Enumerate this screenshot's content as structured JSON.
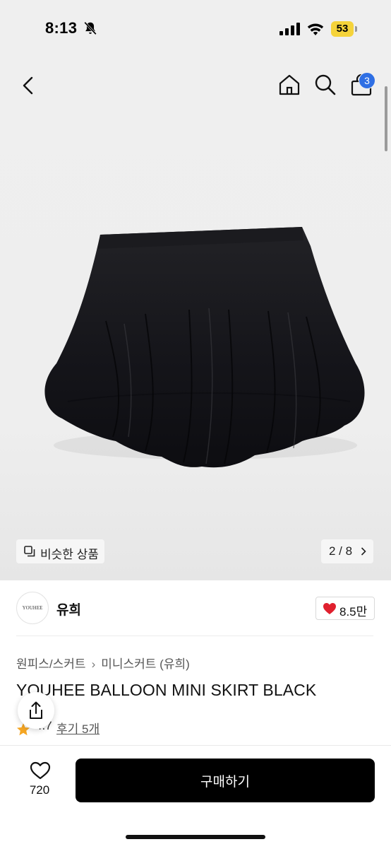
{
  "status_bar": {
    "time": "8:13",
    "battery": "53",
    "battery_color": "#f5d33a"
  },
  "nav": {
    "icons": [
      "chevron-left-icon",
      "home-icon",
      "search-icon",
      "shopping-bag-icon"
    ],
    "cart_badge": "3",
    "badge_color": "#2f6fe4"
  },
  "gallery": {
    "similar_label": "비슷한 상품",
    "page_indicator": "2 / 8"
  },
  "brand": {
    "logo_text": "YOUHEE",
    "name": "유희",
    "likes": "8.5만",
    "heart_color": "#e0202e"
  },
  "product": {
    "breadcrumb": [
      "원피스/스커트",
      "미니스커트 (유희)"
    ],
    "title": "YOUHEE BALLOON MINI SKIRT BLACK",
    "rating": "4.7",
    "reviews": "후기 5개",
    "star_color": "#f5a623"
  },
  "bottom_bar": {
    "wish_count": "720",
    "buy_label": "구매하기",
    "buy_color": "#000000"
  }
}
